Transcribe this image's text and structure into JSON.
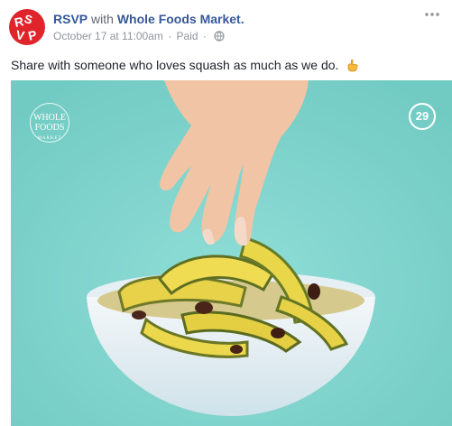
{
  "post": {
    "page_name": "RSVP",
    "with_text": "with",
    "partner_name": "Whole Foods Market.",
    "date": "October 17 at 11:00am",
    "separator": "·",
    "sponsor_label": "Paid",
    "avatar_text": "RSVP",
    "message": "Share with someone who loves squash as much as we do.",
    "message_emoji": "pointing-hand-icon"
  },
  "media": {
    "watermark_left_line1": "WHOLE",
    "watermark_left_line2": "FOODS",
    "watermark_left_line3": "MARKET",
    "watermark_right": "29",
    "background_color": "#7fd4cd"
  },
  "colors": {
    "link_blue": "#365899",
    "meta_grey": "#90949c",
    "brand_red": "#e0242c"
  }
}
